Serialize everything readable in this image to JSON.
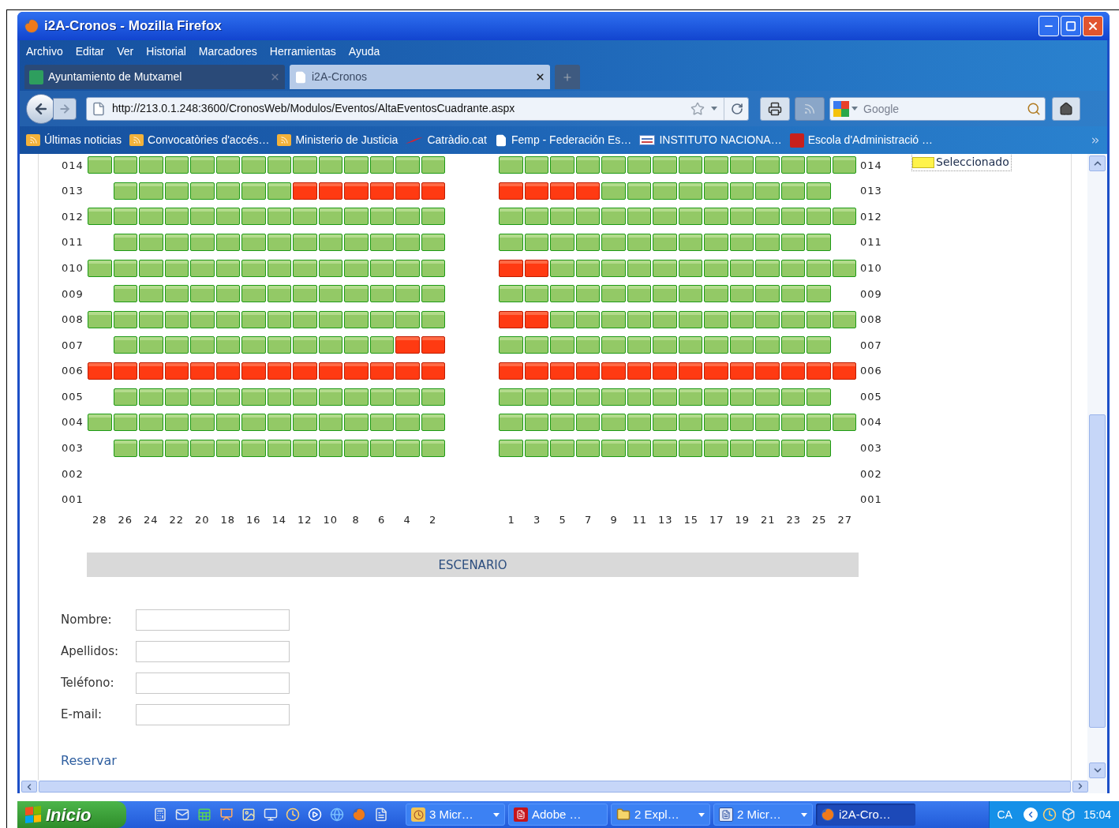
{
  "window": {
    "title": "i2A-Cronos - Mozilla Firefox"
  },
  "menu": [
    "Archivo",
    "Editar",
    "Ver",
    "Historial",
    "Marcadores",
    "Herramientas",
    "Ayuda"
  ],
  "tabs": [
    {
      "label": "Ayuntamiento de Mutxamel",
      "selected": false
    },
    {
      "label": "i2A-Cronos",
      "selected": true
    }
  ],
  "address_bar": {
    "url": "http://213.0.1.248:3600/CronosWeb/Modulos/Eventos/AltaEventosCuadrante.aspx"
  },
  "search": {
    "placeholder": "Google"
  },
  "bookmarks": [
    {
      "label": "Últimas noticias",
      "kind": "feed"
    },
    {
      "label": "Convocatòries d'accés…",
      "kind": "feed"
    },
    {
      "label": "Ministerio de Justicia",
      "kind": "feed"
    },
    {
      "label": "Catràdio.cat",
      "kind": "radio"
    },
    {
      "label": "Femp - Federación Es…",
      "kind": "page"
    },
    {
      "label": "INSTITUTO NACIONA…",
      "kind": "site"
    },
    {
      "label": "Escola d'Administració …",
      "kind": "gencat"
    }
  ],
  "legend": {
    "label": "Seleccionado"
  },
  "seating": {
    "rows": [
      {
        "left_label": "014",
        "right_label": "014",
        "left": [
          {
            "taken": false
          },
          {
            "taken": false
          },
          {
            "taken": false
          },
          {
            "taken": false
          },
          {
            "taken": false
          },
          {
            "taken": false
          },
          {
            "taken": false
          },
          {
            "taken": false
          },
          {
            "taken": false
          },
          {
            "taken": false
          },
          {
            "taken": false
          },
          {
            "taken": false
          },
          {
            "taken": false
          },
          {
            "taken": false
          }
        ],
        "right": [
          {
            "taken": false
          },
          {
            "taken": false
          },
          {
            "taken": false
          },
          {
            "taken": false
          },
          {
            "taken": false
          },
          {
            "taken": false
          },
          {
            "taken": false
          },
          {
            "taken": false
          },
          {
            "taken": false
          },
          {
            "taken": false
          },
          {
            "taken": false
          },
          {
            "taken": false
          },
          {
            "taken": false
          },
          {
            "taken": false
          }
        ]
      },
      {
        "left_label": "013",
        "right_label": "013",
        "left": [
          {
            "taken": false
          },
          {
            "taken": false
          },
          {
            "taken": false
          },
          {
            "taken": false
          },
          {
            "taken": false
          },
          {
            "taken": false
          },
          {
            "taken": false
          },
          {
            "taken": true
          },
          {
            "taken": true
          },
          {
            "taken": true
          },
          {
            "taken": true
          },
          {
            "taken": true
          },
          {
            "taken": true
          }
        ],
        "right": [
          {
            "taken": true
          },
          {
            "taken": true
          },
          {
            "taken": true
          },
          {
            "taken": true
          },
          {
            "taken": false
          },
          {
            "taken": false
          },
          {
            "taken": false
          },
          {
            "taken": false
          },
          {
            "taken": false
          },
          {
            "taken": false
          },
          {
            "taken": false
          },
          {
            "taken": false
          },
          {
            "taken": false
          }
        ]
      },
      {
        "left_label": "012",
        "right_label": "012",
        "left": [
          {
            "taken": false
          },
          {
            "taken": false
          },
          {
            "taken": false
          },
          {
            "taken": false
          },
          {
            "taken": false
          },
          {
            "taken": false
          },
          {
            "taken": false
          },
          {
            "taken": false
          },
          {
            "taken": false
          },
          {
            "taken": false
          },
          {
            "taken": false
          },
          {
            "taken": false
          },
          {
            "taken": false
          },
          {
            "taken": false
          }
        ],
        "right": [
          {
            "taken": false
          },
          {
            "taken": false
          },
          {
            "taken": false
          },
          {
            "taken": false
          },
          {
            "taken": false
          },
          {
            "taken": false
          },
          {
            "taken": false
          },
          {
            "taken": false
          },
          {
            "taken": false
          },
          {
            "taken": false
          },
          {
            "taken": false
          },
          {
            "taken": false
          },
          {
            "taken": false
          },
          {
            "taken": false
          }
        ]
      },
      {
        "left_label": "011",
        "right_label": "011",
        "left": [
          {
            "taken": false
          },
          {
            "taken": false
          },
          {
            "taken": false
          },
          {
            "taken": false
          },
          {
            "taken": false
          },
          {
            "taken": false
          },
          {
            "taken": false
          },
          {
            "taken": false
          },
          {
            "taken": false
          },
          {
            "taken": false
          },
          {
            "taken": false
          },
          {
            "taken": false
          },
          {
            "taken": false
          }
        ],
        "right": [
          {
            "taken": false
          },
          {
            "taken": false
          },
          {
            "taken": false
          },
          {
            "taken": false
          },
          {
            "taken": false
          },
          {
            "taken": false
          },
          {
            "taken": false
          },
          {
            "taken": false
          },
          {
            "taken": false
          },
          {
            "taken": false
          },
          {
            "taken": false
          },
          {
            "taken": false
          },
          {
            "taken": false
          }
        ]
      },
      {
        "left_label": "010",
        "right_label": "010",
        "left": [
          {
            "taken": false
          },
          {
            "taken": false
          },
          {
            "taken": false
          },
          {
            "taken": false
          },
          {
            "taken": false
          },
          {
            "taken": false
          },
          {
            "taken": false
          },
          {
            "taken": false
          },
          {
            "taken": false
          },
          {
            "taken": false
          },
          {
            "taken": false
          },
          {
            "taken": false
          },
          {
            "taken": false
          },
          {
            "taken": false
          }
        ],
        "right": [
          {
            "taken": true
          },
          {
            "taken": true
          },
          {
            "taken": false
          },
          {
            "taken": false
          },
          {
            "taken": false
          },
          {
            "taken": false
          },
          {
            "taken": false
          },
          {
            "taken": false
          },
          {
            "taken": false
          },
          {
            "taken": false
          },
          {
            "taken": false
          },
          {
            "taken": false
          },
          {
            "taken": false
          },
          {
            "taken": false
          }
        ]
      },
      {
        "left_label": "009",
        "right_label": "009",
        "left": [
          {
            "taken": false
          },
          {
            "taken": false
          },
          {
            "taken": false
          },
          {
            "taken": false
          },
          {
            "taken": false
          },
          {
            "taken": false
          },
          {
            "taken": false
          },
          {
            "taken": false
          },
          {
            "taken": false
          },
          {
            "taken": false
          },
          {
            "taken": false
          },
          {
            "taken": false
          },
          {
            "taken": false
          }
        ],
        "right": [
          {
            "taken": false
          },
          {
            "taken": false
          },
          {
            "taken": false
          },
          {
            "taken": false
          },
          {
            "taken": false
          },
          {
            "taken": false
          },
          {
            "taken": false
          },
          {
            "taken": false
          },
          {
            "taken": false
          },
          {
            "taken": false
          },
          {
            "taken": false
          },
          {
            "taken": false
          },
          {
            "taken": false
          }
        ]
      },
      {
        "left_label": "008",
        "right_label": "008",
        "left": [
          {
            "taken": false
          },
          {
            "taken": false
          },
          {
            "taken": false
          },
          {
            "taken": false
          },
          {
            "taken": false
          },
          {
            "taken": false
          },
          {
            "taken": false
          },
          {
            "taken": false
          },
          {
            "taken": false
          },
          {
            "taken": false
          },
          {
            "taken": false
          },
          {
            "taken": false
          },
          {
            "taken": false
          },
          {
            "taken": false
          }
        ],
        "right": [
          {
            "taken": true
          },
          {
            "taken": true
          },
          {
            "taken": false
          },
          {
            "taken": false
          },
          {
            "taken": false
          },
          {
            "taken": false
          },
          {
            "taken": false
          },
          {
            "taken": false
          },
          {
            "taken": false
          },
          {
            "taken": false
          },
          {
            "taken": false
          },
          {
            "taken": false
          },
          {
            "taken": false
          },
          {
            "taken": false
          }
        ]
      },
      {
        "left_label": "007",
        "right_label": "007",
        "left": [
          {
            "taken": false
          },
          {
            "taken": false
          },
          {
            "taken": false
          },
          {
            "taken": false
          },
          {
            "taken": false
          },
          {
            "taken": false
          },
          {
            "taken": false
          },
          {
            "taken": false
          },
          {
            "taken": false
          },
          {
            "taken": false
          },
          {
            "taken": false
          },
          {
            "taken": true
          },
          {
            "taken": true
          }
        ],
        "right": [
          {
            "taken": false
          },
          {
            "taken": false
          },
          {
            "taken": false
          },
          {
            "taken": false
          },
          {
            "taken": false
          },
          {
            "taken": false
          },
          {
            "taken": false
          },
          {
            "taken": false
          },
          {
            "taken": false
          },
          {
            "taken": false
          },
          {
            "taken": false
          },
          {
            "taken": false
          },
          {
            "taken": false
          }
        ]
      },
      {
        "left_label": "006",
        "right_label": "006",
        "left": [
          {
            "taken": true
          },
          {
            "taken": true
          },
          {
            "taken": true
          },
          {
            "taken": true
          },
          {
            "taken": true
          },
          {
            "taken": true
          },
          {
            "taken": true
          },
          {
            "taken": true
          },
          {
            "taken": true
          },
          {
            "taken": true
          },
          {
            "taken": true
          },
          {
            "taken": true
          },
          {
            "taken": true
          },
          {
            "taken": true
          }
        ],
        "right": [
          {
            "taken": true
          },
          {
            "taken": true
          },
          {
            "taken": true
          },
          {
            "taken": true
          },
          {
            "taken": true
          },
          {
            "taken": true
          },
          {
            "taken": true
          },
          {
            "taken": true
          },
          {
            "taken": true
          },
          {
            "taken": true
          },
          {
            "taken": true
          },
          {
            "taken": true
          },
          {
            "taken": true
          },
          {
            "taken": true
          }
        ]
      },
      {
        "left_label": "005",
        "right_label": "005",
        "left": [
          {
            "taken": false
          },
          {
            "taken": false
          },
          {
            "taken": false
          },
          {
            "taken": false
          },
          {
            "taken": false
          },
          {
            "taken": false
          },
          {
            "taken": false
          },
          {
            "taken": false
          },
          {
            "taken": false
          },
          {
            "taken": false
          },
          {
            "taken": false
          },
          {
            "taken": false
          },
          {
            "taken": false
          }
        ],
        "right": [
          {
            "taken": false
          },
          {
            "taken": false
          },
          {
            "taken": false
          },
          {
            "taken": false
          },
          {
            "taken": false
          },
          {
            "taken": false
          },
          {
            "taken": false
          },
          {
            "taken": false
          },
          {
            "taken": false
          },
          {
            "taken": false
          },
          {
            "taken": false
          },
          {
            "taken": false
          },
          {
            "taken": false
          }
        ]
      },
      {
        "left_label": "004",
        "right_label": "004",
        "left": [
          {
            "taken": false
          },
          {
            "taken": false
          },
          {
            "taken": false
          },
          {
            "taken": false
          },
          {
            "taken": false
          },
          {
            "taken": false
          },
          {
            "taken": false
          },
          {
            "taken": false
          },
          {
            "taken": false
          },
          {
            "taken": false
          },
          {
            "taken": false
          },
          {
            "taken": false
          },
          {
            "taken": false
          },
          {
            "taken": false
          }
        ],
        "right": [
          {
            "taken": false
          },
          {
            "taken": false
          },
          {
            "taken": false
          },
          {
            "taken": false
          },
          {
            "taken": false
          },
          {
            "taken": false
          },
          {
            "taken": false
          },
          {
            "taken": false
          },
          {
            "taken": false
          },
          {
            "taken": false
          },
          {
            "taken": false
          },
          {
            "taken": false
          },
          {
            "taken": false
          },
          {
            "taken": false
          }
        ]
      },
      {
        "left_label": "003",
        "right_label": "003",
        "left": [
          {
            "taken": false
          },
          {
            "taken": false
          },
          {
            "taken": false
          },
          {
            "taken": false
          },
          {
            "taken": false
          },
          {
            "taken": false
          },
          {
            "taken": false
          },
          {
            "taken": false
          },
          {
            "taken": false
          },
          {
            "taken": false
          },
          {
            "taken": false
          },
          {
            "taken": false
          },
          {
            "taken": false
          }
        ],
        "right": [
          {
            "taken": false
          },
          {
            "taken": false
          },
          {
            "taken": false
          },
          {
            "taken": false
          },
          {
            "taken": false
          },
          {
            "taken": false
          },
          {
            "taken": false
          },
          {
            "taken": false
          },
          {
            "taken": false
          },
          {
            "taken": false
          },
          {
            "taken": false
          },
          {
            "taken": false
          },
          {
            "taken": false
          }
        ]
      },
      {
        "left_label": "002",
        "right_label": "002"
      },
      {
        "left_label": "001",
        "right_label": "001"
      }
    ],
    "left_numbers": [
      "28",
      "26",
      "24",
      "22",
      "20",
      "18",
      "16",
      "14",
      "12",
      "10",
      "8",
      "6",
      "4",
      "2"
    ],
    "right_numbers": [
      "1",
      "3",
      "5",
      "7",
      "9",
      "11",
      "13",
      "15",
      "17",
      "19",
      "21",
      "23",
      "25",
      "27"
    ]
  },
  "stage": {
    "label": "ESCENARIO"
  },
  "form": {
    "fields": [
      {
        "label": "Nombre:"
      },
      {
        "label": "Apellidos:"
      },
      {
        "label": "Teléfono:"
      },
      {
        "label": "E-mail:"
      }
    ],
    "submit": "Reservar"
  },
  "taskbar": {
    "start": "Inicio",
    "tasks": [
      {
        "label": "3 Micr…",
        "kind": "clock",
        "grouped": true,
        "selected": false
      },
      {
        "label": "Adobe …",
        "kind": "pdf",
        "grouped": false,
        "selected": false
      },
      {
        "label": "2 Expl…",
        "kind": "folder",
        "grouped": true,
        "selected": false
      },
      {
        "label": "2 Micr…",
        "kind": "word",
        "grouped": true,
        "selected": false
      },
      {
        "label": "i2A-Cro…",
        "kind": "browser",
        "grouped": false,
        "selected": true
      }
    ],
    "language": "CA",
    "time": "15:04"
  }
}
